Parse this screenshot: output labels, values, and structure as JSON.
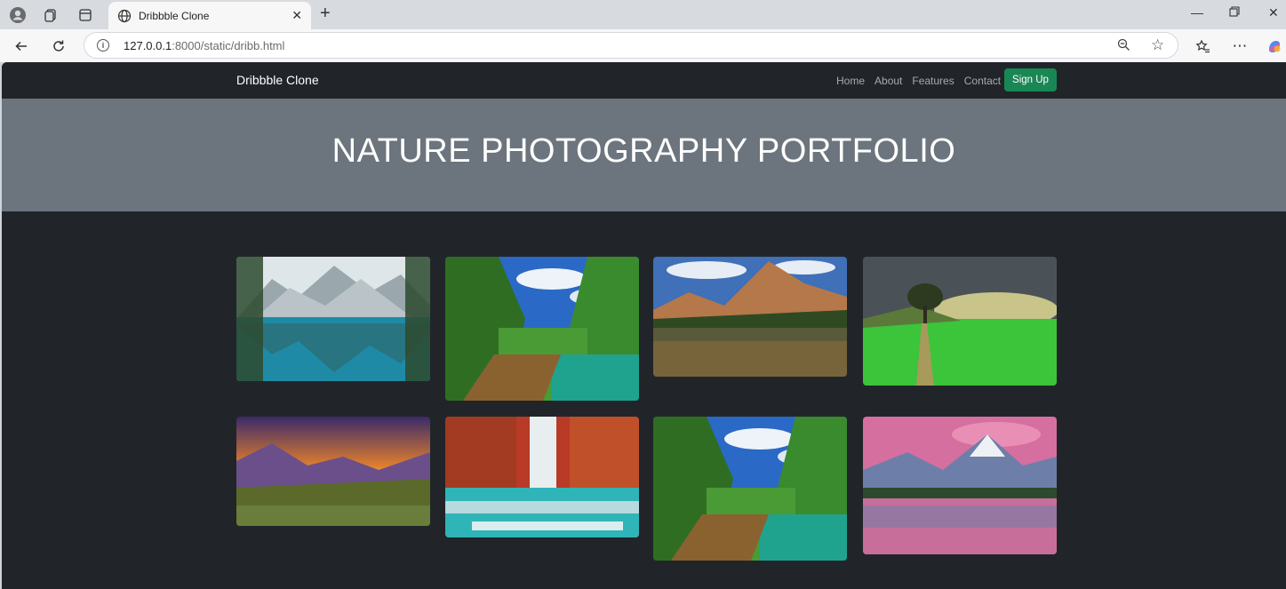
{
  "browser": {
    "tab_title": "Dribbble Clone",
    "url_host": "127.0.0.1",
    "url_rest": ":8000/static/dribb.html"
  },
  "site": {
    "brand": "Dribbble Clone",
    "nav": [
      "Home",
      "About",
      "Features",
      "Contact"
    ],
    "signup_label": "Sign Up",
    "hero_title": "NATURE PHOTOGRAPHY PORTFOLIO"
  },
  "photos": [
    {
      "name": "photo-mountain-lake-reflection",
      "colors": [
        "#c9d3da",
        "#3c6a6f",
        "#1f8aa5"
      ]
    },
    {
      "name": "photo-forest-boardwalk",
      "colors": [
        "#2a69c6",
        "#3a8a2e",
        "#7a5a2e"
      ]
    },
    {
      "name": "photo-red-rock-lake",
      "colors": [
        "#4c7bbd",
        "#a8774c",
        "#3a4a2a"
      ]
    },
    {
      "name": "photo-lone-tree-field",
      "colors": [
        "#4b5257",
        "#9aa06a",
        "#3cc43a"
      ]
    },
    {
      "name": "photo-valley-sunset",
      "colors": [
        "#e07d2e",
        "#6a4f8a",
        "#5b6a2a"
      ]
    },
    {
      "name": "photo-autumn-waterfall",
      "colors": [
        "#b93a26",
        "#d8e4e6",
        "#2fb5b8"
      ]
    },
    {
      "name": "photo-forest-boardwalk-2",
      "colors": [
        "#2a69c6",
        "#3a8a2e",
        "#7a5a2e"
      ]
    },
    {
      "name": "photo-pink-mountain-lake",
      "colors": [
        "#d56fa0",
        "#6d7fa8",
        "#c86e9a"
      ]
    }
  ]
}
